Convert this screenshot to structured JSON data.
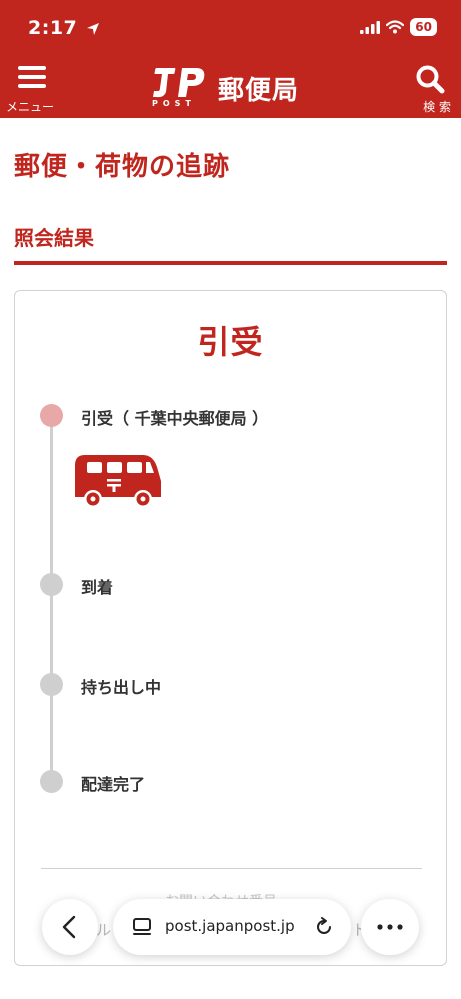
{
  "status_bar": {
    "time": "2:17",
    "battery": "60"
  },
  "header": {
    "menu_label": "メニュー",
    "logo_sub": "POST",
    "logo_text": "郵便局",
    "search_label": "検 索"
  },
  "page": {
    "title": "郵便・荷物の追跡",
    "subtitle": "照会結果"
  },
  "card": {
    "status": "引受",
    "steps": [
      {
        "label": "引受（ 千葉中央郵便局 ）",
        "state": "current"
      },
      {
        "label": "到着",
        "state": "pending"
      },
      {
        "label": "持ち出し中",
        "state": "pending"
      },
      {
        "label": "配達完了",
        "state": "pending"
      }
    ],
    "faded_text": "お問い合わせ番号"
  },
  "browser": {
    "url": "post.japanpost.jp",
    "url_prefix": "ル",
    "url_suffix": "ト"
  },
  "colors": {
    "brand_red": "#c0261e",
    "current_dot": "#e8a8a8",
    "pending_dot": "#cfcfcf"
  }
}
